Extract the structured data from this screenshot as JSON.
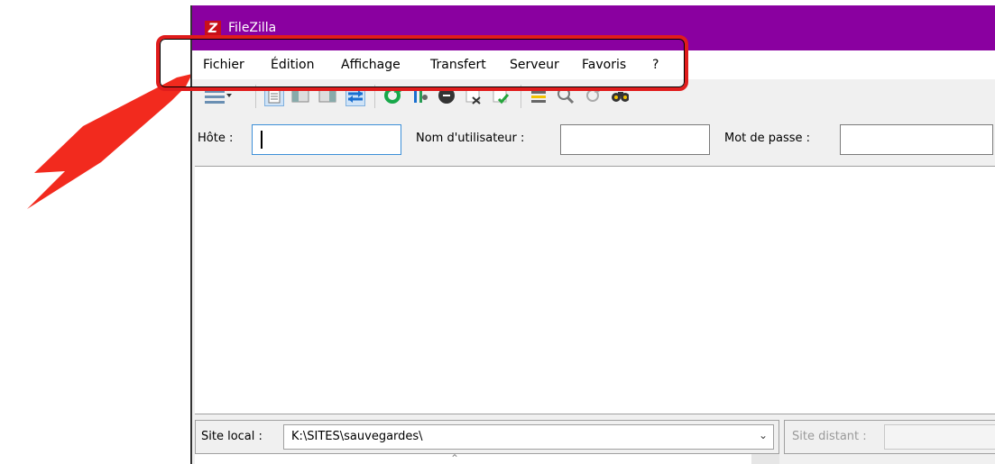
{
  "app": {
    "title": "FileZilla",
    "icon_letter": "Z"
  },
  "menu": [
    "Fichier",
    "Édition",
    "Affichage",
    "Transfert",
    "Serveur",
    "Favoris",
    "?"
  ],
  "toolbar_icons": [
    "site-manager-icon",
    "toggle-log-icon",
    "toggle-local-tree-icon",
    "toggle-remote-tree-icon",
    "toggle-transfer-queue-icon",
    "refresh-icon",
    "process-queue-icon",
    "cancel-operation-icon",
    "disconnect-icon",
    "reconnect-icon",
    "directory-filter-icon",
    "directory-compare-icon",
    "sync-browse-icon",
    "search-icon"
  ],
  "quickconnect": {
    "host_label": "Hôte :",
    "host_value": "",
    "user_label": "Nom d'utilisateur :",
    "user_value": "",
    "pass_label": "Mot de passe :",
    "pass_value": ""
  },
  "local": {
    "label": "Site local :",
    "path": "K:\\SITES\\sauvegardes\\"
  },
  "remote": {
    "label": "Site distant :",
    "path": ""
  },
  "colors": {
    "titlebar": "#8a00a0",
    "highlight": "#e01c1c"
  }
}
